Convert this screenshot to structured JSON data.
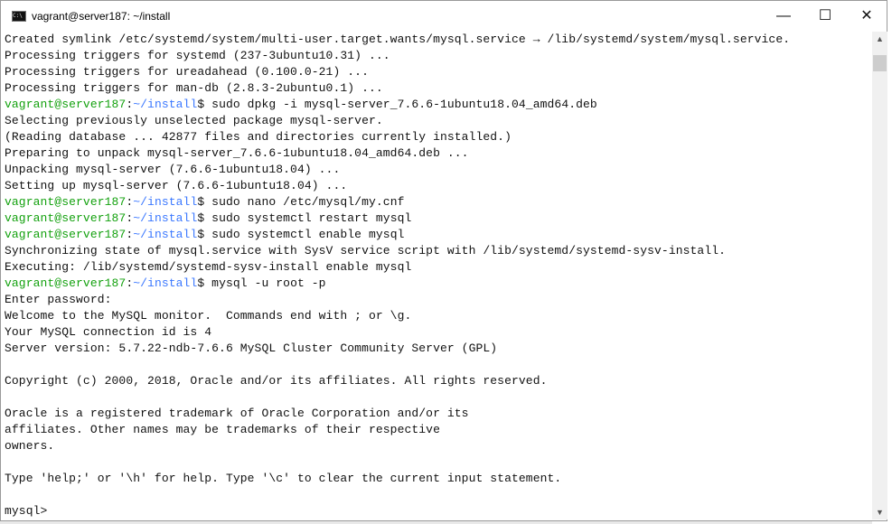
{
  "window": {
    "title": "vagrant@server187: ~/install",
    "minimize": "—",
    "maximize": "☐",
    "close": "✕"
  },
  "colors": {
    "user": "#13a10e",
    "path": "#3b78ff",
    "text": "#111111"
  },
  "lines": [
    {
      "text": "Created symlink /etc/systemd/system/multi-user.target.wants/mysql.service → /lib/systemd/system/mysql.service."
    },
    {
      "text": "Processing triggers for systemd (237-3ubuntu10.31) ..."
    },
    {
      "text": "Processing triggers for ureadahead (0.100.0-21) ..."
    },
    {
      "text": "Processing triggers for man-db (2.8.3-2ubuntu0.1) ..."
    },
    {
      "user": "vagrant@server187",
      "sep": ":",
      "path": "~/install",
      "cmd": "$ sudo dpkg -i mysql-server_7.6.6-1ubuntu18.04_amd64.deb"
    },
    {
      "text": "Selecting previously unselected package mysql-server."
    },
    {
      "text": "(Reading database ... 42877 files and directories currently installed.)"
    },
    {
      "text": "Preparing to unpack mysql-server_7.6.6-1ubuntu18.04_amd64.deb ..."
    },
    {
      "text": "Unpacking mysql-server (7.6.6-1ubuntu18.04) ..."
    },
    {
      "text": "Setting up mysql-server (7.6.6-1ubuntu18.04) ..."
    },
    {
      "user": "vagrant@server187",
      "sep": ":",
      "path": "~/install",
      "cmd": "$ sudo nano /etc/mysql/my.cnf"
    },
    {
      "user": "vagrant@server187",
      "sep": ":",
      "path": "~/install",
      "cmd": "$ sudo systemctl restart mysql"
    },
    {
      "user": "vagrant@server187",
      "sep": ":",
      "path": "~/install",
      "cmd": "$ sudo systemctl enable mysql"
    },
    {
      "text": "Synchronizing state of mysql.service with SysV service script with /lib/systemd/systemd-sysv-install."
    },
    {
      "text": "Executing: /lib/systemd/systemd-sysv-install enable mysql"
    },
    {
      "user": "vagrant@server187",
      "sep": ":",
      "path": "~/install",
      "cmd": "$ mysql -u root -p"
    },
    {
      "text": "Enter password:"
    },
    {
      "text": "Welcome to the MySQL monitor.  Commands end with ; or \\g."
    },
    {
      "text": "Your MySQL connection id is 4"
    },
    {
      "text": "Server version: 5.7.22-ndb-7.6.6 MySQL Cluster Community Server (GPL)"
    },
    {
      "text": ""
    },
    {
      "text": "Copyright (c) 2000, 2018, Oracle and/or its affiliates. All rights reserved."
    },
    {
      "text": ""
    },
    {
      "text": "Oracle is a registered trademark of Oracle Corporation and/or its"
    },
    {
      "text": "affiliates. Other names may be trademarks of their respective"
    },
    {
      "text": "owners."
    },
    {
      "text": ""
    },
    {
      "text": "Type 'help;' or '\\h' for help. Type '\\c' to clear the current input statement."
    },
    {
      "text": ""
    },
    {
      "text": "mysql>"
    }
  ]
}
